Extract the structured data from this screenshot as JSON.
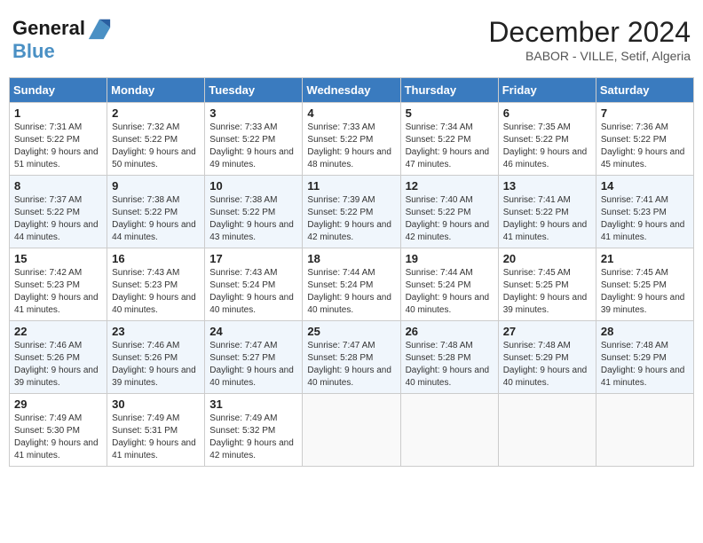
{
  "header": {
    "logo_line1": "General",
    "logo_line2": "Blue",
    "month_title": "December 2024",
    "subtitle": "BABOR - VILLE, Setif, Algeria"
  },
  "weekdays": [
    "Sunday",
    "Monday",
    "Tuesday",
    "Wednesday",
    "Thursday",
    "Friday",
    "Saturday"
  ],
  "weeks": [
    [
      {
        "day": "1",
        "sunrise": "7:31 AM",
        "sunset": "5:22 PM",
        "daylight": "9 hours and 51 minutes."
      },
      {
        "day": "2",
        "sunrise": "7:32 AM",
        "sunset": "5:22 PM",
        "daylight": "9 hours and 50 minutes."
      },
      {
        "day": "3",
        "sunrise": "7:33 AM",
        "sunset": "5:22 PM",
        "daylight": "9 hours and 49 minutes."
      },
      {
        "day": "4",
        "sunrise": "7:33 AM",
        "sunset": "5:22 PM",
        "daylight": "9 hours and 48 minutes."
      },
      {
        "day": "5",
        "sunrise": "7:34 AM",
        "sunset": "5:22 PM",
        "daylight": "9 hours and 47 minutes."
      },
      {
        "day": "6",
        "sunrise": "7:35 AM",
        "sunset": "5:22 PM",
        "daylight": "9 hours and 46 minutes."
      },
      {
        "day": "7",
        "sunrise": "7:36 AM",
        "sunset": "5:22 PM",
        "daylight": "9 hours and 45 minutes."
      }
    ],
    [
      {
        "day": "8",
        "sunrise": "7:37 AM",
        "sunset": "5:22 PM",
        "daylight": "9 hours and 44 minutes."
      },
      {
        "day": "9",
        "sunrise": "7:38 AM",
        "sunset": "5:22 PM",
        "daylight": "9 hours and 44 minutes."
      },
      {
        "day": "10",
        "sunrise": "7:38 AM",
        "sunset": "5:22 PM",
        "daylight": "9 hours and 43 minutes."
      },
      {
        "day": "11",
        "sunrise": "7:39 AM",
        "sunset": "5:22 PM",
        "daylight": "9 hours and 42 minutes."
      },
      {
        "day": "12",
        "sunrise": "7:40 AM",
        "sunset": "5:22 PM",
        "daylight": "9 hours and 42 minutes."
      },
      {
        "day": "13",
        "sunrise": "7:41 AM",
        "sunset": "5:22 PM",
        "daylight": "9 hours and 41 minutes."
      },
      {
        "day": "14",
        "sunrise": "7:41 AM",
        "sunset": "5:23 PM",
        "daylight": "9 hours and 41 minutes."
      }
    ],
    [
      {
        "day": "15",
        "sunrise": "7:42 AM",
        "sunset": "5:23 PM",
        "daylight": "9 hours and 41 minutes."
      },
      {
        "day": "16",
        "sunrise": "7:43 AM",
        "sunset": "5:23 PM",
        "daylight": "9 hours and 40 minutes."
      },
      {
        "day": "17",
        "sunrise": "7:43 AM",
        "sunset": "5:24 PM",
        "daylight": "9 hours and 40 minutes."
      },
      {
        "day": "18",
        "sunrise": "7:44 AM",
        "sunset": "5:24 PM",
        "daylight": "9 hours and 40 minutes."
      },
      {
        "day": "19",
        "sunrise": "7:44 AM",
        "sunset": "5:24 PM",
        "daylight": "9 hours and 40 minutes."
      },
      {
        "day": "20",
        "sunrise": "7:45 AM",
        "sunset": "5:25 PM",
        "daylight": "9 hours and 39 minutes."
      },
      {
        "day": "21",
        "sunrise": "7:45 AM",
        "sunset": "5:25 PM",
        "daylight": "9 hours and 39 minutes."
      }
    ],
    [
      {
        "day": "22",
        "sunrise": "7:46 AM",
        "sunset": "5:26 PM",
        "daylight": "9 hours and 39 minutes."
      },
      {
        "day": "23",
        "sunrise": "7:46 AM",
        "sunset": "5:26 PM",
        "daylight": "9 hours and 39 minutes."
      },
      {
        "day": "24",
        "sunrise": "7:47 AM",
        "sunset": "5:27 PM",
        "daylight": "9 hours and 40 minutes."
      },
      {
        "day": "25",
        "sunrise": "7:47 AM",
        "sunset": "5:28 PM",
        "daylight": "9 hours and 40 minutes."
      },
      {
        "day": "26",
        "sunrise": "7:48 AM",
        "sunset": "5:28 PM",
        "daylight": "9 hours and 40 minutes."
      },
      {
        "day": "27",
        "sunrise": "7:48 AM",
        "sunset": "5:29 PM",
        "daylight": "9 hours and 40 minutes."
      },
      {
        "day": "28",
        "sunrise": "7:48 AM",
        "sunset": "5:29 PM",
        "daylight": "9 hours and 41 minutes."
      }
    ],
    [
      {
        "day": "29",
        "sunrise": "7:49 AM",
        "sunset": "5:30 PM",
        "daylight": "9 hours and 41 minutes."
      },
      {
        "day": "30",
        "sunrise": "7:49 AM",
        "sunset": "5:31 PM",
        "daylight": "9 hours and 41 minutes."
      },
      {
        "day": "31",
        "sunrise": "7:49 AM",
        "sunset": "5:32 PM",
        "daylight": "9 hours and 42 minutes."
      },
      null,
      null,
      null,
      null
    ]
  ]
}
